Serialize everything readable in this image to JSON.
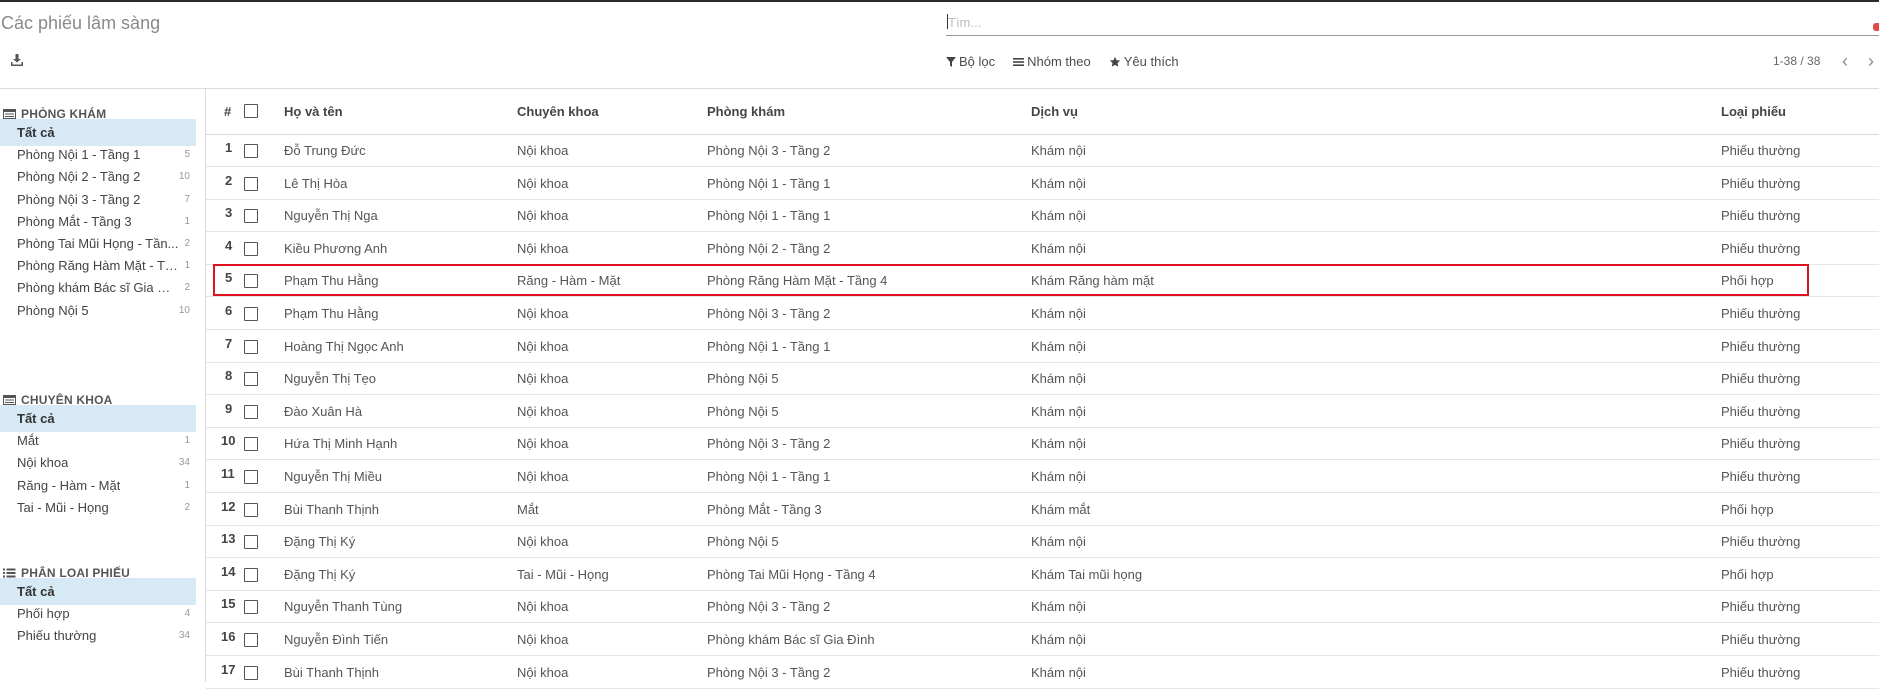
{
  "header": {
    "title": "Các phiếu lâm sàng",
    "search_placeholder": "Tìm...",
    "filter_label": "Bộ lọc",
    "group_label": "Nhóm theo",
    "favorite_label": "Yêu thích",
    "pager_text": "1-38 / 38",
    "icons": {
      "download": "download-icon",
      "filter": "filter-icon",
      "group": "list-icon",
      "favorite": "star-icon",
      "prev": "chevron-left-icon",
      "next": "chevron-right-icon"
    }
  },
  "sidebar": {
    "sections": [
      {
        "title": "PHÒNG KHÁM",
        "items": [
          {
            "label": "Tất cả",
            "count": ""
          },
          {
            "label": "Phòng Nội 1 - Tầng 1",
            "count": "5"
          },
          {
            "label": "Phòng Nội 2 - Tầng 2",
            "count": "10"
          },
          {
            "label": "Phòng Nội 3 - Tầng 2",
            "count": "7"
          },
          {
            "label": "Phòng Mắt - Tầng 3",
            "count": "1"
          },
          {
            "label": "Phòng Tai Mũi Họng - Tần...",
            "count": "2"
          },
          {
            "label": "Phòng Răng Hàm Mặt - Tầ...",
            "count": "1"
          },
          {
            "label": "Phòng khám Bác sĩ Gia Đì...",
            "count": "2"
          },
          {
            "label": "Phòng Nội 5",
            "count": "10"
          }
        ]
      },
      {
        "title": "CHUYÊN KHOA",
        "items": [
          {
            "label": "Tất cả",
            "count": ""
          },
          {
            "label": "Mắt",
            "count": "1"
          },
          {
            "label": "Nội khoa",
            "count": "34"
          },
          {
            "label": "Răng - Hàm - Mặt",
            "count": "1"
          },
          {
            "label": "Tai - Mũi - Họng",
            "count": "2"
          }
        ]
      },
      {
        "title": "PHÂN LOẠI PHIẾU",
        "items": [
          {
            "label": "Tất cả",
            "count": ""
          },
          {
            "label": "Phối hợp",
            "count": "4"
          },
          {
            "label": "Phiếu thường",
            "count": "34"
          }
        ]
      }
    ]
  },
  "table": {
    "columns": {
      "num": "#",
      "name": "Họ và tên",
      "specialty": "Chuyên khoa",
      "room": "Phòng khám",
      "service": "Dịch vụ",
      "type": "Loại phiếu"
    },
    "rows": [
      {
        "num": "1",
        "name": "Đỗ Trung Đức",
        "specialty": "Nội khoa",
        "room": "Phòng Nội 3 - Tầng 2",
        "service": "Khám nội",
        "type": "Phiếu thường"
      },
      {
        "num": "2",
        "name": "Lê Thị Hòa",
        "specialty": "Nội khoa",
        "room": "Phòng Nội 1 - Tầng 1",
        "service": "Khám nội",
        "type": "Phiếu thường"
      },
      {
        "num": "3",
        "name": "Nguyễn Thị Nga",
        "specialty": "Nội khoa",
        "room": "Phòng Nội 1 - Tầng 1",
        "service": "Khám nội",
        "type": "Phiếu thường"
      },
      {
        "num": "4",
        "name": "Kiều Phương Anh",
        "specialty": "Nội khoa",
        "room": "Phòng Nội 2 - Tầng 2",
        "service": "Khám nội",
        "type": "Phiếu thường"
      },
      {
        "num": "5",
        "name": "Phạm Thu Hằng",
        "specialty": "Răng - Hàm - Mặt",
        "room": "Phòng Răng Hàm Mặt - Tầng 4",
        "service": "Khám Răng hàm mặt",
        "type": "Phối hợp"
      },
      {
        "num": "6",
        "name": "Phạm Thu Hằng",
        "specialty": "Nội khoa",
        "room": "Phòng Nội 3 - Tầng 2",
        "service": "Khám nội",
        "type": "Phiếu thường"
      },
      {
        "num": "7",
        "name": "Hoàng Thị Ngọc Anh",
        "specialty": "Nội khoa",
        "room": "Phòng Nội 1 - Tầng 1",
        "service": "Khám nội",
        "type": "Phiếu thường"
      },
      {
        "num": "8",
        "name": "Nguyễn Thị Tẹo",
        "specialty": "Nội khoa",
        "room": "Phòng Nội 5",
        "service": "Khám nội",
        "type": "Phiếu thường"
      },
      {
        "num": "9",
        "name": "Đào Xuân Hà",
        "specialty": "Nội khoa",
        "room": "Phòng Nội 5",
        "service": "Khám nội",
        "type": "Phiếu thường"
      },
      {
        "num": "10",
        "name": "Hứa Thị Minh Hạnh",
        "specialty": "Nội khoa",
        "room": "Phòng Nội 3 - Tầng 2",
        "service": "Khám nội",
        "type": "Phiếu thường"
      },
      {
        "num": "11",
        "name": "Nguyễn Thị Miều",
        "specialty": "Nội khoa",
        "room": "Phòng Nội 1 - Tầng 1",
        "service": "Khám nội",
        "type": "Phiếu thường"
      },
      {
        "num": "12",
        "name": "Bùi Thanh Thịnh",
        "specialty": "Mắt",
        "room": "Phòng Mắt - Tầng 3",
        "service": "Khám mắt",
        "type": "Phối hợp"
      },
      {
        "num": "13",
        "name": "Đặng Thị Ký",
        "specialty": "Nội khoa",
        "room": "Phòng Nội 5",
        "service": "Khám nội",
        "type": "Phiếu thường"
      },
      {
        "num": "14",
        "name": "Đặng Thị Ký",
        "specialty": "Tai - Mũi - Họng",
        "room": "Phòng Tai Mũi Họng - Tầng 4",
        "service": "Khám Tai mũi họng",
        "type": "Phối hợp"
      },
      {
        "num": "15",
        "name": "Nguyễn Thanh Tùng",
        "specialty": "Nội khoa",
        "room": "Phòng Nội 3 - Tầng 2",
        "service": "Khám nội",
        "type": "Phiếu thường"
      },
      {
        "num": "16",
        "name": "Nguyễn Đình Tiến",
        "specialty": "Nội khoa",
        "room": "Phòng khám Bác sĩ Gia Đình",
        "service": "Khám nội",
        "type": "Phiếu thường"
      },
      {
        "num": "17",
        "name": "Bùi Thanh Thịnh",
        "specialty": "Nội khoa",
        "room": "Phòng Nội 3 - Tầng 2",
        "service": "Khám nội",
        "type": "Phiếu thường"
      }
    ],
    "highlighted_row": "5",
    "highlight_color": "#e0121f"
  }
}
